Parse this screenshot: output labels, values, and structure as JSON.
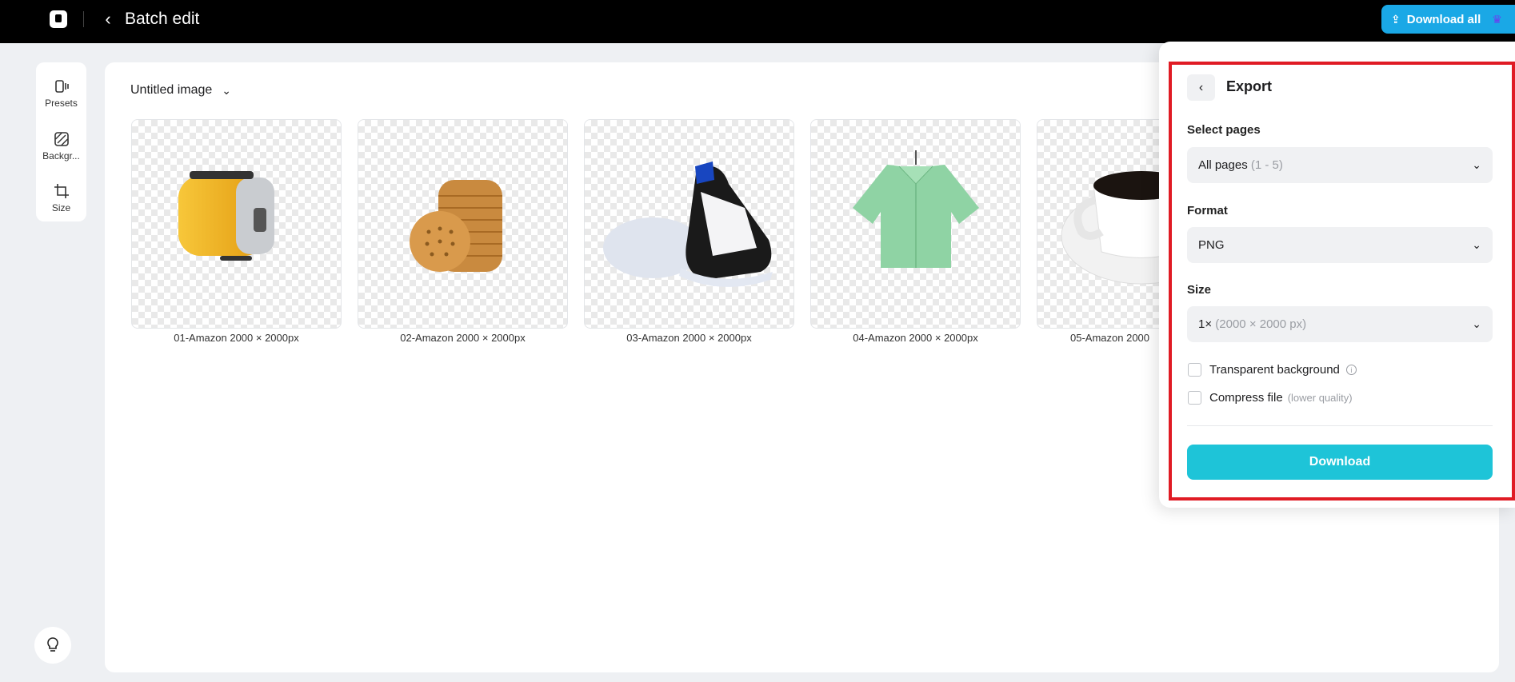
{
  "header": {
    "title": "Batch edit",
    "download_all_label": "Download all"
  },
  "rail": {
    "items": [
      {
        "label": "Presets",
        "icon": "presets-icon"
      },
      {
        "label": "Backgr...",
        "icon": "background-icon"
      },
      {
        "label": "Size",
        "icon": "crop-icon"
      }
    ]
  },
  "document": {
    "name": "Untitled image"
  },
  "images": [
    {
      "caption": "01-Amazon 2000 × 2000px",
      "subject": "toaster"
    },
    {
      "caption": "02-Amazon 2000 × 2000px",
      "subject": "crackers"
    },
    {
      "caption": "03-Amazon 2000 × 2000px",
      "subject": "sneaker"
    },
    {
      "caption": "04-Amazon 2000 × 2000px",
      "subject": "shirt"
    },
    {
      "caption": "05-Amazon 2000",
      "subject": "coffee cup"
    }
  ],
  "export": {
    "title": "Export",
    "select_pages_label": "Select pages",
    "pages_value": "All pages",
    "pages_range": "(1 - 5)",
    "format_label": "Format",
    "format_value": "PNG",
    "size_label": "Size",
    "size_value": "1×",
    "size_detail": "(2000 × 2000 px)",
    "transparent_label": "Transparent background",
    "compress_label": "Compress file",
    "compress_hint": "(lower quality)",
    "download_label": "Download"
  },
  "colors": {
    "accent": "#1ec4d8",
    "download_all_bg": "#1aa8e6",
    "highlight": "#e01b24"
  }
}
